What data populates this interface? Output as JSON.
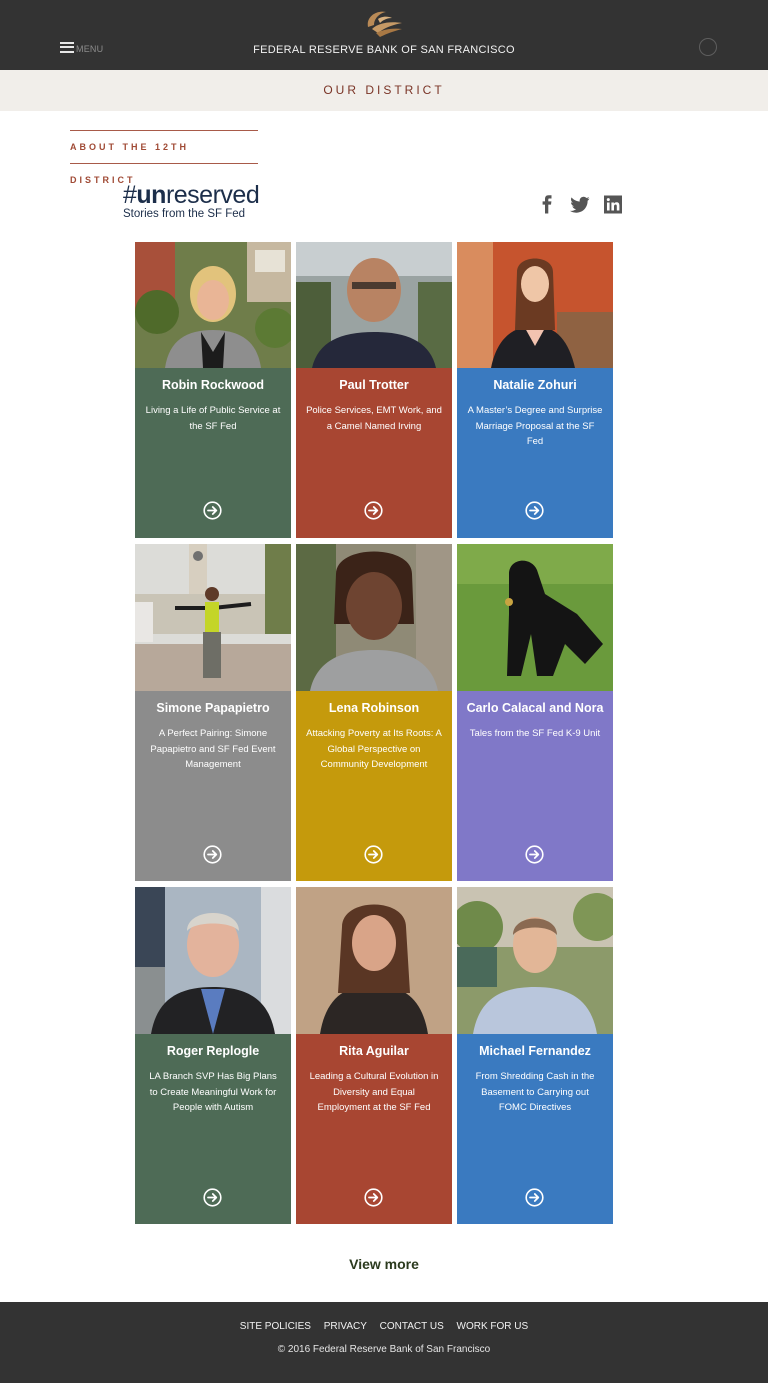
{
  "header": {
    "menu_label": "MENU",
    "site_title": "FEDERAL RESERVE BANK OF SAN FRANCISCO"
  },
  "district_bar": {
    "label": "OUR DISTRICT"
  },
  "section_label": "ABOUT THE 12TH DISTRICT",
  "brand": {
    "hash": "#",
    "hash_bold": "un",
    "hash_rest": "reserved",
    "subtitle": "Stories from the SF Fed"
  },
  "social": {
    "facebook_icon": "facebook-icon",
    "twitter_icon": "twitter-icon",
    "linkedin_icon": "linkedin-icon"
  },
  "colors": {
    "green": "#4e6b56",
    "red": "#a84632",
    "blue": "#3a7ac0",
    "gray": "#8c8c8c",
    "gold": "#c59a0c",
    "purple": "#8078c8",
    "header": "#333333",
    "accent": "#a04a35"
  },
  "stories": [
    {
      "name": "Robin Rockwood",
      "desc": "Living a Life of Public Service at the SF Fed",
      "color": "green"
    },
    {
      "name": "Paul Trotter",
      "desc": "Police Services, EMT Work, and a Camel Named Irving",
      "color": "red"
    },
    {
      "name": "Natalie Zohuri",
      "desc": "A Master’s Degree and Surprise Marriage Proposal at the SF Fed",
      "color": "blue"
    },
    {
      "name": "Simone Papapietro",
      "desc": "A Perfect Pairing: Simone Papapietro and SF Fed Event Management",
      "color": "gray"
    },
    {
      "name": "Lena Robinson",
      "desc": "Attacking Poverty at Its Roots: A Global Perspective on Community Development",
      "color": "gold"
    },
    {
      "name": "Carlo Calacal and Nora",
      "desc": "Tales from the SF Fed K-9 Unit",
      "color": "purple"
    },
    {
      "name": "Roger Replogle",
      "desc": "LA Branch SVP Has Big Plans to Create Meaningful Work for People with Autism",
      "color": "green"
    },
    {
      "name": "Rita Aguilar",
      "desc": "Leading a Cultural Evolution in Diversity and Equal Employment at the SF Fed",
      "color": "red"
    },
    {
      "name": "Michael Fernandez",
      "desc": "From Shredding Cash in the Basement to Carrying out FOMC Directives",
      "color": "blue"
    }
  ],
  "view_more": "View more",
  "footer": {
    "links": [
      "SITE POLICIES",
      "PRIVACY",
      "CONTACT US",
      "WORK FOR US"
    ],
    "copyright": "© 2016 Federal Reserve Bank of San Francisco"
  }
}
